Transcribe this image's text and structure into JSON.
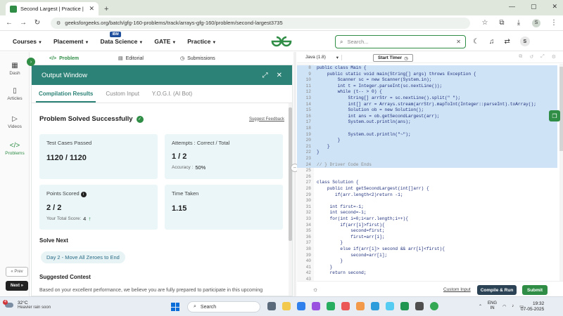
{
  "browser": {
    "tab_title": "Second Largest | Practice | Geeks",
    "url": "geeksforgeeks.org/batch/gfg-160-problems/track/arrays-gfg-160/problem/second-largest3735"
  },
  "header": {
    "menu": [
      {
        "label": "Courses"
      },
      {
        "label": "Placement"
      },
      {
        "label": "Data Science",
        "badge": "IBM"
      },
      {
        "label": "GATE"
      },
      {
        "label": "Practice"
      }
    ],
    "search_placeholder": "Search...",
    "avatar_initial": "S"
  },
  "sidebar": {
    "items": [
      {
        "label": "Dash",
        "icon": "dashboard-icon"
      },
      {
        "label": "Articles",
        "icon": "articles-icon"
      },
      {
        "label": "Videos",
        "icon": "video-icon"
      },
      {
        "label": "Problems",
        "icon": "code-icon"
      }
    ],
    "prev_label": "« Prev",
    "next_label": "Next »"
  },
  "problem_tabs": [
    {
      "label": "Problem"
    },
    {
      "label": "Editorial"
    },
    {
      "label": "Submissions"
    }
  ],
  "output": {
    "title": "Output Window",
    "tabs": [
      {
        "label": "Compilation Results"
      },
      {
        "label": "Custom Input"
      },
      {
        "label": "Y.O.G.I. (AI Bot)"
      }
    ],
    "status": "Problem Solved Successfully",
    "feedback": "Suggest Feedback",
    "cards": {
      "test_cases_label": "Test Cases Passed",
      "test_cases_value": "1120 / 1120",
      "attempts_label": "Attempts : Correct / Total",
      "attempts_value": "1 / 2",
      "accuracy_label": "Accuracy :",
      "accuracy_value": "50%",
      "points_label": "Points Scored",
      "points_value": "2 / 2",
      "total_score_label": "Your Total Score:",
      "total_score_value": "4",
      "time_label": "Time Taken",
      "time_value": "1.15"
    },
    "solve_next_title": "Solve Next",
    "solve_next_item": "Day 2 - Move All Zeroes to End",
    "suggested_contest_title": "Suggested Contest",
    "suggested_contest_text": "Based on your excellent performance, we believe you are fully prepared to participate in this upcoming"
  },
  "editor": {
    "language": "Java (1.8)",
    "start_timer": "Start Timer",
    "lines": [
      {
        "n": "8",
        "text": "public class Main {",
        "sel": true
      },
      {
        "n": "9",
        "text": "    public static void main(String[] args) throws Exception {",
        "sel": true
      },
      {
        "n": "10",
        "text": "        Scanner sc = new Scanner(System.in);",
        "sel": true
      },
      {
        "n": "11",
        "text": "        int t = Integer.parseInt(sc.nextLine());",
        "sel": true
      },
      {
        "n": "12",
        "text": "        while (t-- > 0) {",
        "sel": true
      },
      {
        "n": "13",
        "text": "            String[] arrStr = sc.nextLine().split(\" \");",
        "sel": true
      },
      {
        "n": "14",
        "text": "            int[] arr = Arrays.stream(arrStr).mapToInt(Integer::parseInt).toArray();",
        "sel": true
      },
      {
        "n": "15",
        "text": "            Solution ob = new Solution();",
        "sel": true
      },
      {
        "n": "16",
        "text": "            int ans = ob.getSecondLargest(arr);",
        "sel": true
      },
      {
        "n": "17",
        "text": "            System.out.println(ans);",
        "sel": true
      },
      {
        "n": "18",
        "text": "",
        "sel": true
      },
      {
        "n": "19",
        "text": "            System.out.println(\"~\");",
        "sel": true
      },
      {
        "n": "20",
        "text": "        }",
        "sel": true
      },
      {
        "n": "21",
        "text": "    }",
        "sel": true
      },
      {
        "n": "22",
        "text": "}",
        "sel": true
      },
      {
        "n": "23",
        "text": "",
        "sel": true
      },
      {
        "n": "24",
        "text": "// } Driver Code Ends",
        "sel": true,
        "comment": true
      },
      {
        "n": "25",
        "text": "",
        "sel": false
      },
      {
        "n": "26",
        "text": "",
        "sel": false
      },
      {
        "n": "27",
        "text": "class Solution {",
        "sel": false
      },
      {
        "n": "28",
        "text": "    public int getSecondLargest(int[]arr) {",
        "sel": false
      },
      {
        "n": "29",
        "text": "       if(arr.length<2)return -1;",
        "sel": false
      },
      {
        "n": "30",
        "text": "",
        "sel": false
      },
      {
        "n": "31",
        "text": "     int first=-1;",
        "sel": false
      },
      {
        "n": "32",
        "text": "     int second=-1;",
        "sel": false
      },
      {
        "n": "33",
        "text": "     for(int i=0;i<arr.length;i++){",
        "sel": false
      },
      {
        "n": "34",
        "text": "         if(arr[i]>first){",
        "sel": false
      },
      {
        "n": "35",
        "text": "             second=first;",
        "sel": false
      },
      {
        "n": "36",
        "text": "             first=arr[i];",
        "sel": false
      },
      {
        "n": "37",
        "text": "         }",
        "sel": false
      },
      {
        "n": "38",
        "text": "         else if(arr[i]> second && arr[i]<first){",
        "sel": false
      },
      {
        "n": "39",
        "text": "             second=arr[i];",
        "sel": false
      },
      {
        "n": "40",
        "text": "         }",
        "sel": false
      },
      {
        "n": "41",
        "text": "     }",
        "sel": false
      },
      {
        "n": "42",
        "text": "     return second;",
        "sel": false
      },
      {
        "n": "43",
        "text": "",
        "sel": false
      },
      {
        "n": "44",
        "text": "    }}",
        "sel": false
      }
    ],
    "custom_input": "Custom Input",
    "compile_label": "Compile & Run",
    "submit_label": "Submit"
  },
  "taskbar": {
    "weather_badge": "4",
    "temperature": "32°C",
    "weather_desc": "Heavier rain soon",
    "search_label": "Search",
    "lang_top": "ENG",
    "lang_bottom": "IN",
    "time": "19:32",
    "date": "07-05-2025"
  },
  "colors": {
    "brand_green": "#2f8d46",
    "output_header": "#2c8276",
    "compile_button": "#2b4355",
    "selection": "#cfe3f6"
  }
}
